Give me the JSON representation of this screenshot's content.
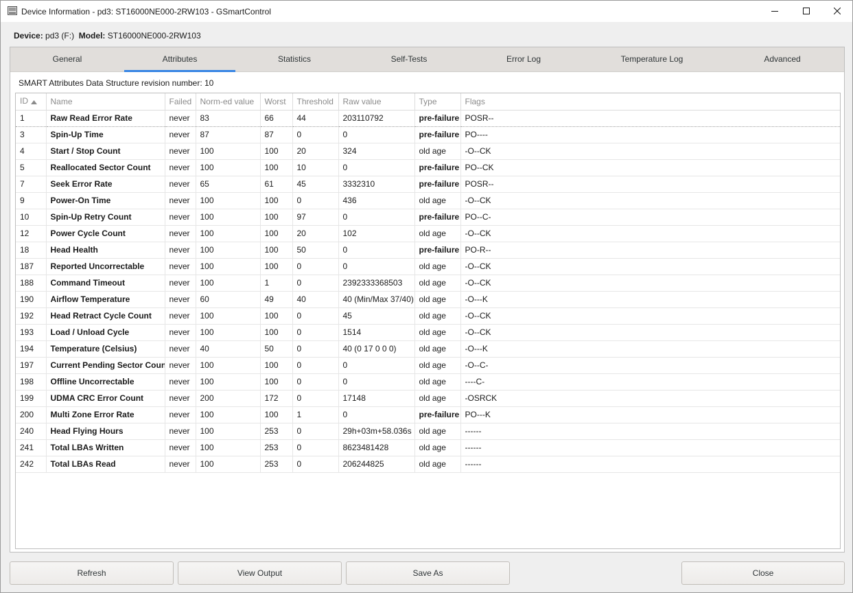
{
  "window": {
    "title": "Device Information - pd3: ST16000NE000-2RW103 - GSmartControl",
    "icon": "disk-drive-icon",
    "controls": {
      "minimize": "minimize-icon",
      "maximize": "maximize-icon",
      "close": "close-icon"
    }
  },
  "device": {
    "device_label": "Device:",
    "device_value": "pd3 (F:)",
    "model_label": "Model:",
    "model_value": "ST16000NE000-2RW103"
  },
  "tabs": [
    {
      "label": "General",
      "active": false
    },
    {
      "label": "Attributes",
      "active": true
    },
    {
      "label": "Statistics",
      "active": false
    },
    {
      "label": "Self-Tests",
      "active": false
    },
    {
      "label": "Error Log",
      "active": false
    },
    {
      "label": "Temperature Log",
      "active": false
    },
    {
      "label": "Advanced",
      "active": false
    }
  ],
  "attributes": {
    "revision_text": "SMART Attributes Data Structure revision number: 10",
    "columns": [
      "ID",
      "Name",
      "Failed",
      "Norm-ed value",
      "Worst",
      "Threshold",
      "Raw value",
      "Type",
      "Flags"
    ],
    "sort": {
      "column": "ID",
      "direction": "ascending",
      "icon": "sort-ascending-icon"
    },
    "selected_row": 0,
    "rows": [
      {
        "id": "1",
        "name": "Raw Read Error Rate",
        "failed": "never",
        "norm": "83",
        "worst": "66",
        "threshold": "44",
        "raw": "203110792",
        "type": "pre-failure",
        "flags": "POSR--"
      },
      {
        "id": "3",
        "name": "Spin-Up Time",
        "failed": "never",
        "norm": "87",
        "worst": "87",
        "threshold": "0",
        "raw": "0",
        "type": "pre-failure",
        "flags": "PO----"
      },
      {
        "id": "4",
        "name": "Start / Stop Count",
        "failed": "never",
        "norm": "100",
        "worst": "100",
        "threshold": "20",
        "raw": "324",
        "type": "old age",
        "flags": "-O--CK"
      },
      {
        "id": "5",
        "name": "Reallocated Sector Count",
        "failed": "never",
        "norm": "100",
        "worst": "100",
        "threshold": "10",
        "raw": "0",
        "type": "pre-failure",
        "flags": "PO--CK"
      },
      {
        "id": "7",
        "name": "Seek Error Rate",
        "failed": "never",
        "norm": "65",
        "worst": "61",
        "threshold": "45",
        "raw": "3332310",
        "type": "pre-failure",
        "flags": "POSR--"
      },
      {
        "id": "9",
        "name": "Power-On Time",
        "failed": "never",
        "norm": "100",
        "worst": "100",
        "threshold": "0",
        "raw": "436",
        "type": "old age",
        "flags": "-O--CK"
      },
      {
        "id": "10",
        "name": "Spin-Up Retry Count",
        "failed": "never",
        "norm": "100",
        "worst": "100",
        "threshold": "97",
        "raw": "0",
        "type": "pre-failure",
        "flags": "PO--C-"
      },
      {
        "id": "12",
        "name": "Power Cycle Count",
        "failed": "never",
        "norm": "100",
        "worst": "100",
        "threshold": "20",
        "raw": "102",
        "type": "old age",
        "flags": "-O--CK"
      },
      {
        "id": "18",
        "name": "Head Health",
        "failed": "never",
        "norm": "100",
        "worst": "100",
        "threshold": "50",
        "raw": "0",
        "type": "pre-failure",
        "flags": "PO-R--"
      },
      {
        "id": "187",
        "name": "Reported Uncorrectable",
        "failed": "never",
        "norm": "100",
        "worst": "100",
        "threshold": "0",
        "raw": "0",
        "type": "old age",
        "flags": "-O--CK"
      },
      {
        "id": "188",
        "name": "Command Timeout",
        "failed": "never",
        "norm": "100",
        "worst": "1",
        "threshold": "0",
        "raw": "2392333368503",
        "type": "old age",
        "flags": "-O--CK"
      },
      {
        "id": "190",
        "name": "Airflow Temperature",
        "failed": "never",
        "norm": "60",
        "worst": "49",
        "threshold": "40",
        "raw": "40 (Min/Max 37/40)",
        "type": "old age",
        "flags": "-O---K"
      },
      {
        "id": "192",
        "name": "Head Retract Cycle Count",
        "failed": "never",
        "norm": "100",
        "worst": "100",
        "threshold": "0",
        "raw": "45",
        "type": "old age",
        "flags": "-O--CK"
      },
      {
        "id": "193",
        "name": "Load / Unload Cycle",
        "failed": "never",
        "norm": "100",
        "worst": "100",
        "threshold": "0",
        "raw": "1514",
        "type": "old age",
        "flags": "-O--CK"
      },
      {
        "id": "194",
        "name": "Temperature (Celsius)",
        "failed": "never",
        "norm": "40",
        "worst": "50",
        "threshold": "0",
        "raw": "40 (0 17 0 0 0)",
        "type": "old age",
        "flags": "-O---K"
      },
      {
        "id": "197",
        "name": "Current Pending Sector Count",
        "failed": "never",
        "norm": "100",
        "worst": "100",
        "threshold": "0",
        "raw": "0",
        "type": "old age",
        "flags": "-O--C-"
      },
      {
        "id": "198",
        "name": "Offline Uncorrectable",
        "failed": "never",
        "norm": "100",
        "worst": "100",
        "threshold": "0",
        "raw": "0",
        "type": "old age",
        "flags": "----C-"
      },
      {
        "id": "199",
        "name": "UDMA CRC Error Count",
        "failed": "never",
        "norm": "200",
        "worst": "172",
        "threshold": "0",
        "raw": "17148",
        "type": "old age",
        "flags": "-OSRCK"
      },
      {
        "id": "200",
        "name": "Multi Zone Error Rate",
        "failed": "never",
        "norm": "100",
        "worst": "100",
        "threshold": "1",
        "raw": "0",
        "type": "pre-failure",
        "flags": "PO---K"
      },
      {
        "id": "240",
        "name": "Head Flying Hours",
        "failed": "never",
        "norm": "100",
        "worst": "253",
        "threshold": "0",
        "raw": "29h+03m+58.036s",
        "type": "old age",
        "flags": "------"
      },
      {
        "id": "241",
        "name": "Total LBAs Written",
        "failed": "never",
        "norm": "100",
        "worst": "253",
        "threshold": "0",
        "raw": "8623481428",
        "type": "old age",
        "flags": "------"
      },
      {
        "id": "242",
        "name": "Total LBAs Read",
        "failed": "never",
        "norm": "100",
        "worst": "253",
        "threshold": "0",
        "raw": "206244825",
        "type": "old age",
        "flags": "------"
      }
    ]
  },
  "buttons": {
    "refresh": "Refresh",
    "view_output": "View Output",
    "save_as": "Save As",
    "close": "Close"
  }
}
